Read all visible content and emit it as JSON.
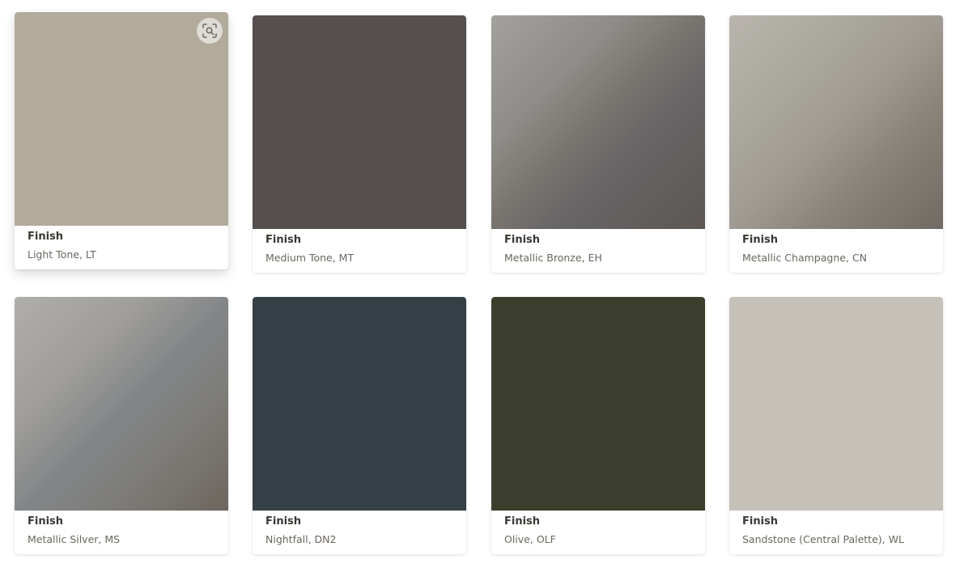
{
  "finishes": [
    {
      "label": "Finish",
      "name": "Light Tone, LT",
      "color": "#b2aa9b"
    },
    {
      "label": "Finish",
      "name": "Medium Tone, MT",
      "color": "#55504d"
    },
    {
      "label": "Finish",
      "name": "Metallic Bronze, EH",
      "color": "#7e7973"
    },
    {
      "label": "Finish",
      "name": "Metallic Champagne, CN",
      "color": "#a39e95"
    },
    {
      "label": "Finish",
      "name": "Metallic Silver, MS",
      "color": "#8c8b88"
    },
    {
      "label": "Finish",
      "name": "Nightfall, DN2",
      "color": "#353f46"
    },
    {
      "label": "Finish",
      "name": "Olive, OLF",
      "color": "#3c3e2d"
    },
    {
      "label": "Finish",
      "name": "Sandstone (Central Palette), WL",
      "color": "#c5c1b9"
    }
  ],
  "hover_card_index": 0,
  "zoom_icon": "focus-zoom-icon"
}
